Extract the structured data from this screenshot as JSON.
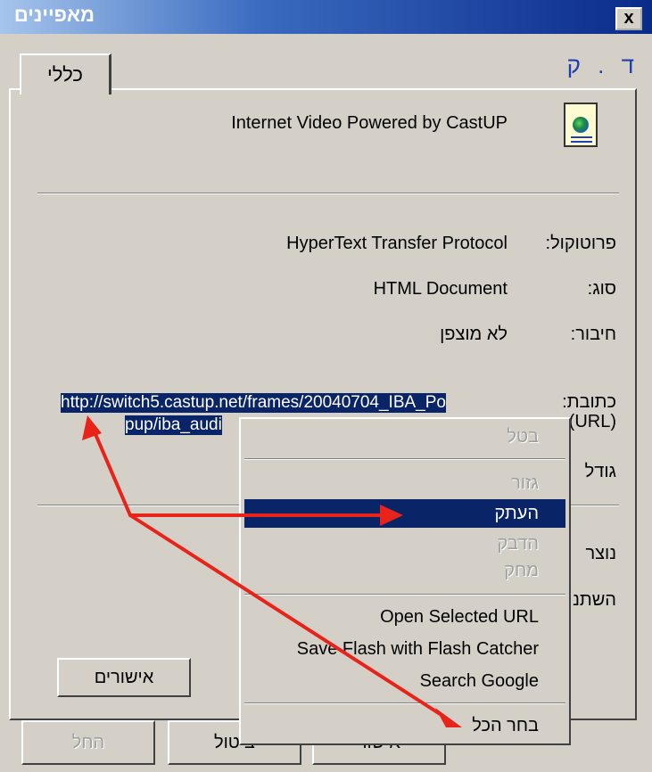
{
  "window": {
    "title": "מאפיינים",
    "close_label": "x"
  },
  "tabs": [
    {
      "label": "כללי"
    }
  ],
  "corner_label": "ד . ק",
  "item_name": "Internet Video Powered by CastUP",
  "properties": {
    "protocol_label": "פרוטוקול:",
    "protocol_value": "HyperText Transfer Protocol",
    "type_label": "סוג:",
    "type_value": "HTML Document",
    "connection_label": "חיבור:",
    "connection_value": "לא מוצפן",
    "address_label": "כתובת:",
    "address_label2": "(URL)",
    "address_line1": "http://switch5.castup.net/frames/20040704_IBA_Po",
    "address_line2": "pup/iba_audi",
    "size_label": "גודל",
    "created_label": "נוצר",
    "modified_label": "השתנ"
  },
  "buttons": {
    "certificates": "אישורים",
    "ok": "אישור",
    "cancel": "ביטול",
    "apply": "החל"
  },
  "context_menu": {
    "items": [
      {
        "label": "בטל",
        "disabled": true
      },
      {
        "label": "גזור",
        "disabled": true
      },
      {
        "label": "העתק",
        "disabled": false,
        "highlighted": true
      },
      {
        "label": "הדבק",
        "disabled": true
      },
      {
        "label": "מחק",
        "disabled": true
      },
      {
        "label": "Open Selected URL",
        "disabled": false
      },
      {
        "label": "Save Flash with Flash Catcher",
        "disabled": false
      },
      {
        "label": "Search Google",
        "disabled": false
      },
      {
        "label": "בחר הכל",
        "disabled": false
      }
    ]
  },
  "colors": {
    "selection": "#0a2468",
    "annotation_arrow": "#e8231a",
    "dialog_bg": "#d4d0c8"
  }
}
